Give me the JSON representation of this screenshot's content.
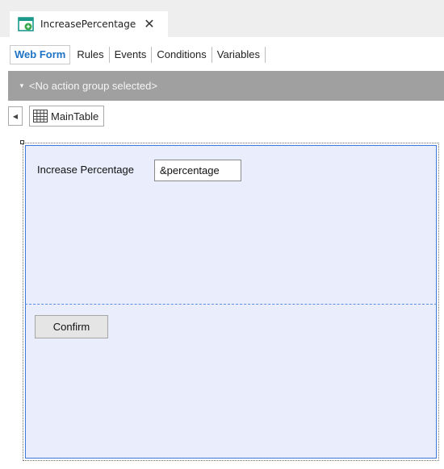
{
  "document_tab": {
    "title": "IncreasePercentage",
    "close_glyph": "✕",
    "icon": "webpanel-icon"
  },
  "subtabs": [
    {
      "label": "Web Form",
      "active": true
    },
    {
      "label": "Rules"
    },
    {
      "label": "Events"
    },
    {
      "label": "Conditions"
    },
    {
      "label": "Variables"
    }
  ],
  "action_bar": {
    "caret": "▼",
    "label": "<No action group selected>"
  },
  "breadcrumb": {
    "back_glyph": "◀",
    "item_label": "MainTable",
    "icon": "table-grid-icon"
  },
  "form": {
    "field_label": "Increase Percentage",
    "field_value": "&percentage",
    "confirm_label": "Confirm"
  },
  "colors": {
    "accent": "#1e73c4",
    "action_bar": "#a0a0a0",
    "canvas_fill": "#eaeefc",
    "canvas_border": "#3c78d8"
  }
}
